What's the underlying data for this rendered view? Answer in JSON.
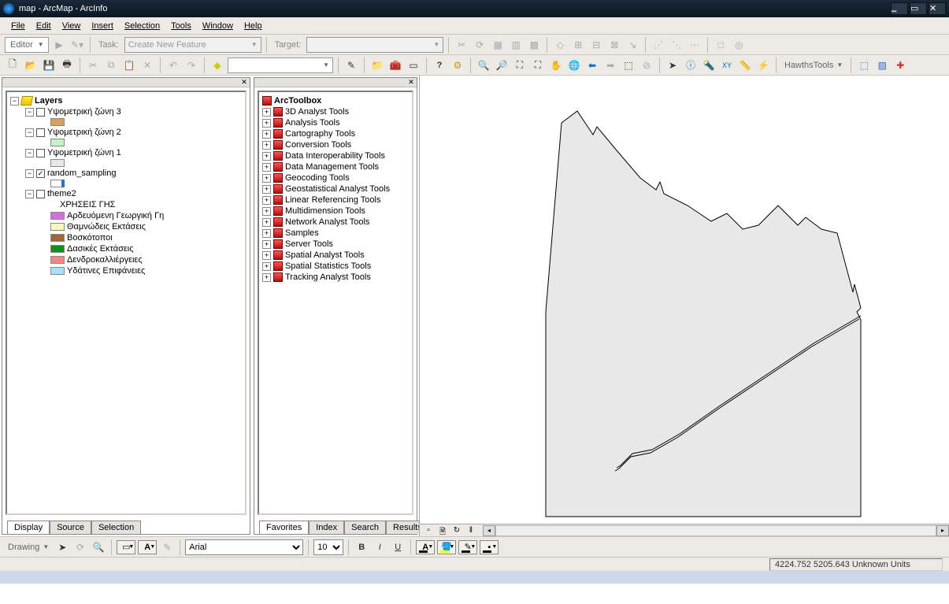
{
  "title": "map - ArcMap - ArcInfo",
  "menu": [
    "File",
    "Edit",
    "View",
    "Insert",
    "Selection",
    "Tools",
    "Window",
    "Help"
  ],
  "editor": {
    "label": "Editor",
    "task_label": "Task:",
    "task_value": "Create New Feature",
    "target_label": "Target:",
    "target_value": ""
  },
  "hawths": "HawthsTools",
  "toc": {
    "root": "Layers",
    "items": [
      {
        "name": "Υψομετρική ζώνη 3",
        "checked": false,
        "swatch": "#d8a060"
      },
      {
        "name": "Υψομετρική ζώνη 2",
        "checked": false,
        "swatch": "#c8f0c8"
      },
      {
        "name": "Υψομετρική ζώνη 1",
        "checked": false,
        "swatch": "#e8e8e8"
      },
      {
        "name": "random_sampling",
        "checked": true,
        "swatch": "#ffffff",
        "swatch_border": "#3070c0"
      },
      {
        "name": "theme2",
        "checked": false,
        "expanded": true,
        "heading": "ΧΡΗΣΕΙΣ ΓΗΣ",
        "classes": [
          {
            "c": "#d070d8",
            "l": "Αρδευόμενη Γεωργική Γη"
          },
          {
            "c": "#f8f8c0",
            "l": "Θαμνώδεις Εκτάσεις"
          },
          {
            "c": "#a06838",
            "l": "Βοσκότοποι"
          },
          {
            "c": "#109018",
            "l": "Δασικές Εκτάσεις"
          },
          {
            "c": "#f08888",
            "l": "Δενδροκαλλιέργειες"
          },
          {
            "c": "#a8e0f8",
            "l": "Υδάτινες Επιφάνειες"
          }
        ]
      }
    ],
    "tabs": [
      "Display",
      "Source",
      "Selection"
    ]
  },
  "arctoolbox": {
    "title": "ArcToolbox",
    "items": [
      "3D Analyst Tools",
      "Analysis Tools",
      "Cartography Tools",
      "Conversion Tools",
      "Data Interoperability Tools",
      "Data Management Tools",
      "Geocoding Tools",
      "Geostatistical Analyst Tools",
      "Linear Referencing Tools",
      "Multidimension Tools",
      "Network Analyst Tools",
      "Samples",
      "Server Tools",
      "Spatial Analyst Tools",
      "Spatial Statistics Tools",
      "Tracking Analyst Tools"
    ],
    "tabs": [
      "Favorites",
      "Index",
      "Search",
      "Results"
    ]
  },
  "drawing": {
    "label": "Drawing",
    "font": "Arial",
    "size": "10"
  },
  "status": "4224.752  5205.643 Unknown Units"
}
